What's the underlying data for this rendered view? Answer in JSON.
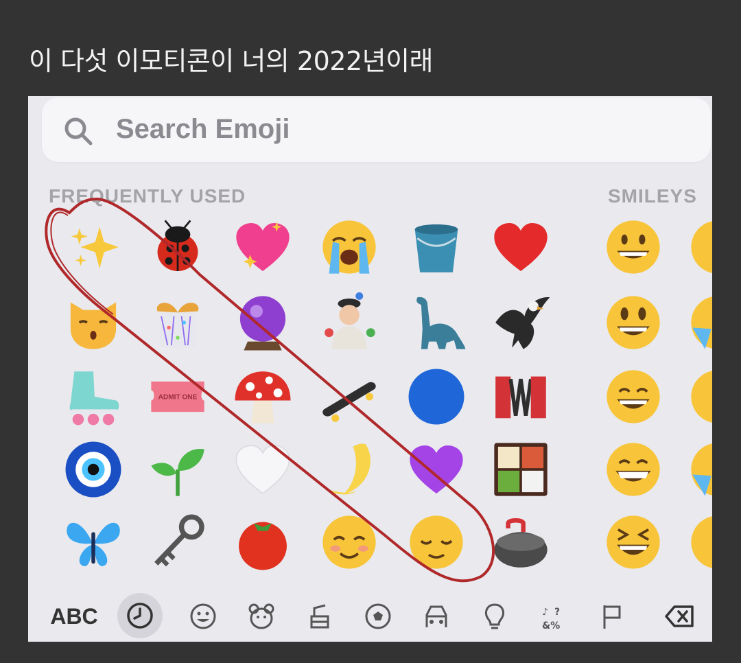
{
  "post": {
    "caption": "이 다섯 이모티콘이 너의 2022년이래"
  },
  "keyboard": {
    "search": {
      "placeholder": "Search Emoji"
    },
    "sections": {
      "frequently_used": "FREQUENTLY USED",
      "smileys": "SMILEYS"
    },
    "frequently_used_emojis": [
      [
        "sparkles",
        "lady-beetle",
        "sparkling-heart",
        "loudly-crying-face",
        "bucket",
        "red-heart"
      ],
      [
        "kissing-cat",
        "wrapped-gift",
        "crystal-ball",
        "juggling-person",
        "sauropod",
        "eagle"
      ],
      [
        "roller-skate",
        "admission-ticket",
        "mushroom",
        "skateboard",
        "blue-circle",
        "accordion"
      ],
      [
        "nazar-amulet",
        "seedling",
        "white-heart",
        "crescent-moon",
        "purple-heart",
        "bento-box"
      ],
      [
        "butterfly",
        "old-key",
        "tomato",
        "smiling-face",
        "relieved-face",
        "curling-stone"
      ]
    ],
    "smiley_emojis": [
      "grinning-face",
      "grinning-face-big-eyes",
      "grinning-face-smiling-eyes",
      "beaming-face",
      "grinning-squinting-face"
    ],
    "ticket_text": "ADMIT ONE",
    "annotation": {
      "color": "#b0282a",
      "circled": "diagonal-five"
    },
    "toolbar": {
      "abc_label": "ABC",
      "active_tab": "recents",
      "tabs": [
        "recents",
        "smileys",
        "animals",
        "food",
        "activity",
        "travel",
        "objects",
        "symbols",
        "flags",
        "delete"
      ]
    }
  }
}
